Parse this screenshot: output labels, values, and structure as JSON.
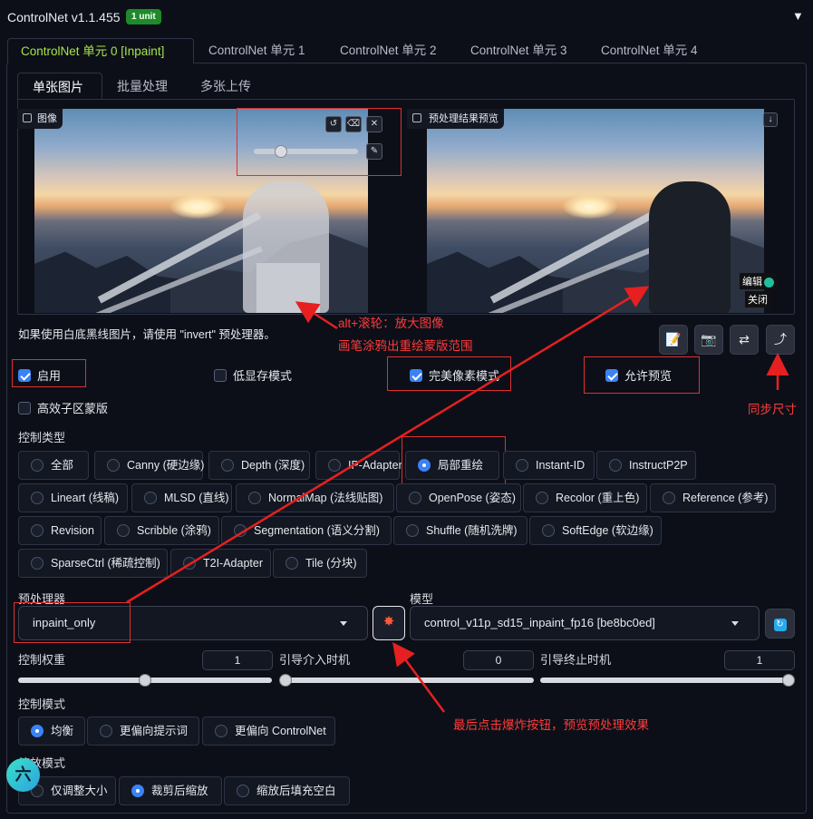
{
  "header": {
    "title": "ControlNet v1.1.455",
    "badge": "1 unit",
    "collapse_icon": "triangle-down-icon"
  },
  "unit_tabs": [
    "ControlNet 单元 0 [Inpaint]",
    "ControlNet 单元 1",
    "ControlNet 单元 2",
    "ControlNet 单元 3",
    "ControlNet 单元 4"
  ],
  "sub_tabs": [
    "单张图片",
    "批量处理",
    "多张上传"
  ],
  "image_panel": {
    "label": "图像"
  },
  "preview_panel": {
    "label": "预处理结果预览",
    "edit_label": "编辑",
    "close_label": "关闭"
  },
  "note": "如果使用白底黑线图片，请使用 \"invert\" 预处理器。",
  "annotations": {
    "zoom_line1": "alt+滚轮：放大图像",
    "zoom_line2": "画笔涂鸦出重绘蒙版范围",
    "sync": "同步尺寸",
    "explode": "最后点击爆炸按钮，预览预处理效果"
  },
  "checkboxes": {
    "enable": {
      "label": "启用",
      "checked": true
    },
    "lowvram": {
      "label": "低显存模式",
      "checked": false
    },
    "pixel_perfect": {
      "label": "完美像素模式",
      "checked": true
    },
    "allow_preview": {
      "label": "允许预览",
      "checked": true
    },
    "effective_mask": {
      "label": "高效子区蒙版",
      "checked": false
    }
  },
  "control_type": {
    "label": "控制类型",
    "selected": "局部重绘",
    "options": [
      "全部",
      "Canny (硬边缘)",
      "Depth (深度)",
      "IP-Adapter",
      "局部重绘",
      "Instant-ID",
      "InstructP2P",
      "Lineart (线稿)",
      "MLSD (直线)",
      "NormalMap (法线贴图)",
      "OpenPose (姿态)",
      "Recolor (重上色)",
      "Reference (参考)",
      "Revision",
      "Scribble (涂鸦)",
      "Segmentation (语义分割)",
      "Shuffle (随机洗牌)",
      "SoftEdge (软边缘)",
      "SparseCtrl (稀疏控制)",
      "T2I-Adapter",
      "Tile (分块)"
    ]
  },
  "preprocessor": {
    "label": "预处理器",
    "value": "inpaint_only"
  },
  "model": {
    "label": "模型",
    "value": "control_v11p_sd15_inpaint_fp16 [be8bc0ed]"
  },
  "weight": {
    "label": "控制权重",
    "value": "1",
    "fraction": 0.5
  },
  "guidance_start": {
    "label": "引导介入时机",
    "value": "0",
    "fraction": 0
  },
  "guidance_end": {
    "label": "引导终止时机",
    "value": "1",
    "fraction": 1
  },
  "control_mode": {
    "label": "控制模式",
    "selected": "均衡",
    "options": [
      "均衡",
      "更偏向提示词",
      "更偏向 ControlNet"
    ]
  },
  "resize_mode": {
    "label": "缩放模式",
    "selected": "裁剪后缩放",
    "options": [
      "仅调整大小",
      "裁剪后缩放",
      "缩放后填充空白"
    ]
  },
  "floating_avatar": "六"
}
